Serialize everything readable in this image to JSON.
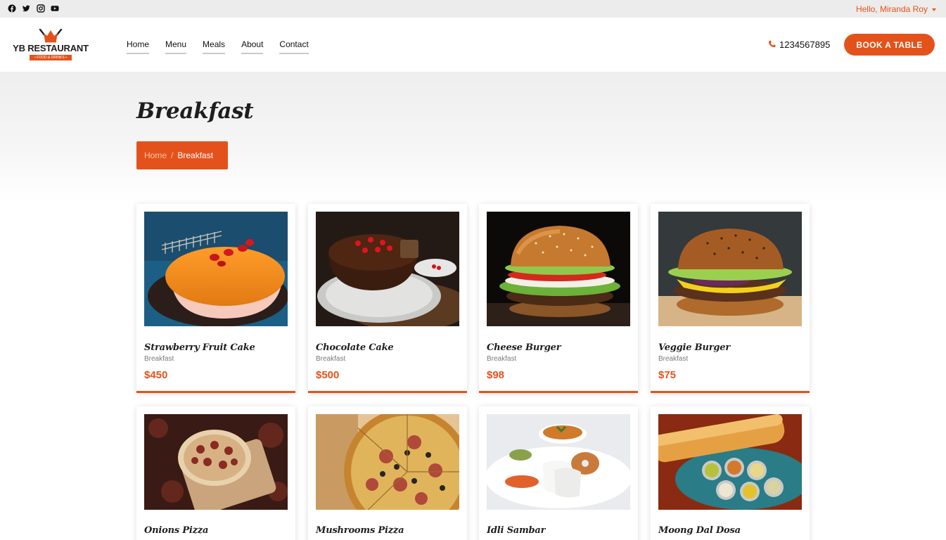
{
  "topbar": {
    "social_icons": [
      "facebook-icon",
      "twitter-icon",
      "instagram-icon",
      "youtube-icon"
    ],
    "user_greeting": "Hello, Miranda Roy"
  },
  "header": {
    "logo": {
      "name": "YB RESTAURANT",
      "tagline": "• FOOD & DRINKS •"
    },
    "nav": [
      "Home",
      "Menu",
      "Meals",
      "About",
      "Contact"
    ],
    "phone": "1234567895",
    "book_button": "BOOK A TABLE"
  },
  "hero": {
    "title": "Breakfast",
    "breadcrumb": {
      "home": "Home",
      "separator": "/",
      "current": "Breakfast"
    }
  },
  "menu_items": [
    {
      "name": "Strawberry Fruit Cake",
      "category": "Breakfast",
      "price": "$450"
    },
    {
      "name": "Chocolate Cake",
      "category": "Breakfast",
      "price": "$500"
    },
    {
      "name": "Cheese Burger",
      "category": "Breakfast",
      "price": "$98"
    },
    {
      "name": "Veggie Burger",
      "category": "Breakfast",
      "price": "$75"
    },
    {
      "name": "Onions Pizza"
    },
    {
      "name": "Mushrooms Pizza"
    },
    {
      "name": "Idli Sambar"
    },
    {
      "name": "Moong Dal Dosa"
    }
  ],
  "colors": {
    "accent": "#e4521c",
    "topbar": "#ececec",
    "text": "#1e1e1e"
  }
}
